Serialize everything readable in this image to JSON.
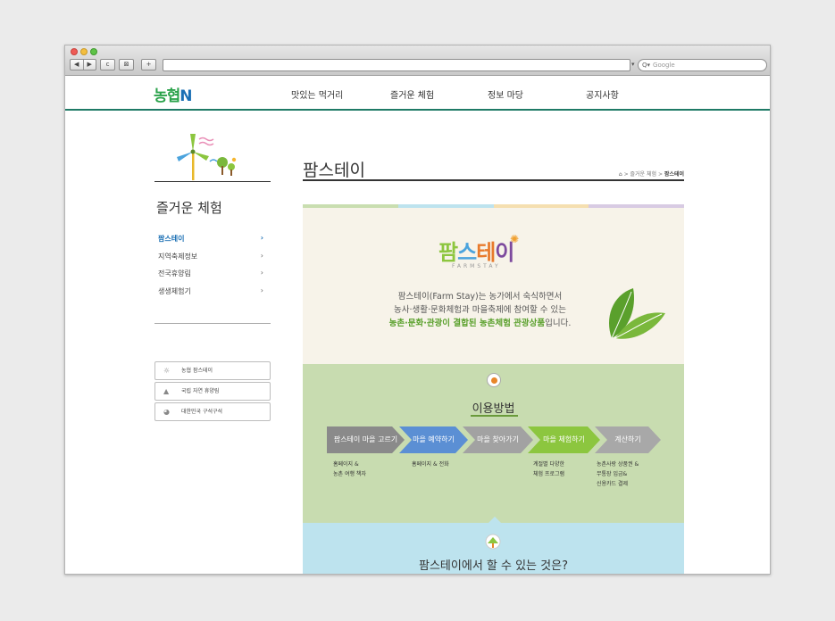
{
  "browser": {
    "back_icon": "◀",
    "forward_icon": "▶",
    "reload_icon": "c",
    "bookmark_icon": "⊠",
    "newtab_icon": "+",
    "search_placeholder": "Google",
    "search_icon": "Q▾"
  },
  "site": {
    "logo_main": "농협",
    "logo_n": "N",
    "menu": [
      "맛있는 먹거리",
      "즐거운 체험",
      "정보 마당",
      "공지사항"
    ]
  },
  "sidebar": {
    "title": "즐거운 체험",
    "items": [
      "팜스테이",
      "지역축제정보",
      "전국휴양림",
      "생생체험기"
    ],
    "arrow": "›",
    "banners": [
      "농협 팜스테이",
      "국립 자연 휴양림",
      "대한민국 구석구석"
    ]
  },
  "content": {
    "title": "팜스테이",
    "breadcrumb": [
      "즐거운 체험",
      "팜스테이"
    ],
    "crumb_sep": ">",
    "brand": [
      "팜",
      "스",
      "테",
      "이"
    ],
    "brand_sub": "FARMSTAY",
    "desc": {
      "line1": "팜스테이(Farm Stay)는 농가에서 숙식하면서",
      "line2": "농사·생활·문화체험과 마을축제에  참여할 수 있는",
      "line3a": "농촌·문화·관광이 결합된 농촌체험 관광상품",
      "line3b": "입니다."
    },
    "howto_title": "이용방법",
    "steps": [
      {
        "label": "팜스테이 마을 고르기",
        "color": "#8a8a8a",
        "note": [
          "홈페이지 &",
          "농촌 여행 책자"
        ]
      },
      {
        "label": "마을 예약하기",
        "color": "#5b8fd4",
        "note": [
          "홈페이지 & 전화"
        ]
      },
      {
        "label": "마을 찾아가기",
        "color": "#a2a2a2",
        "note": []
      },
      {
        "label": "마을 체험하기",
        "color": "#8cc63f",
        "note": [
          "계절별 다양한",
          "체험 프로그램"
        ]
      },
      {
        "label": "계산하기",
        "color": "#a8a8a8",
        "note": [
          "농촌사랑 상품권 &",
          "무통장 입금&",
          "신용카드 결제"
        ]
      }
    ],
    "cando_title": "팜스테이에서 할 수 있는 것은?"
  },
  "colors": {
    "accent_green": "#1f7a66",
    "brand_blue": "#1a6fb4",
    "stripes": [
      "#c9deb0",
      "#bde3ee",
      "#f5dfb0",
      "#d8cbe3"
    ]
  }
}
